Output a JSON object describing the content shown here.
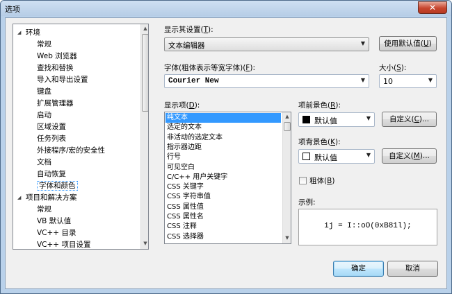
{
  "window": {
    "title": "选项",
    "close_glyph": "✕"
  },
  "tree": {
    "items": [
      {
        "label": "环境",
        "level": 0,
        "expander": "◢"
      },
      {
        "label": "常规",
        "level": 1
      },
      {
        "label": "Web 浏览器",
        "level": 1
      },
      {
        "label": "查找和替换",
        "level": 1
      },
      {
        "label": "导入和导出设置",
        "level": 1
      },
      {
        "label": "键盘",
        "level": 1
      },
      {
        "label": "扩展管理器",
        "level": 1
      },
      {
        "label": "启动",
        "level": 1
      },
      {
        "label": "区域设置",
        "level": 1
      },
      {
        "label": "任务列表",
        "level": 1
      },
      {
        "label": "外接程序/宏的安全性",
        "level": 1
      },
      {
        "label": "文档",
        "level": 1
      },
      {
        "label": "自动恢复",
        "level": 1
      },
      {
        "label": "字体和颜色",
        "level": 1,
        "selected": true
      },
      {
        "label": "项目和解决方案",
        "level": 0,
        "expander": "◢"
      },
      {
        "label": "常规",
        "level": 1
      },
      {
        "label": "VB 默认值",
        "level": 1
      },
      {
        "label": "VC++ 目录",
        "level": 1
      },
      {
        "label": "VC++ 项目设置",
        "level": 1
      }
    ]
  },
  "show_settings_for": {
    "label": "显示其设置(",
    "mnemonic": "T",
    "suffix": "):",
    "value": "文本编辑器"
  },
  "use_defaults_button": {
    "label": "使用默认值(",
    "mnemonic": "U",
    "suffix": ")"
  },
  "font": {
    "label": "字体(粗体表示等宽字体)(",
    "mnemonic": "F",
    "suffix": "):",
    "value": "Courier New"
  },
  "size": {
    "label": "大小(",
    "mnemonic": "S",
    "suffix": "):",
    "value": "10"
  },
  "display_items": {
    "label": "显示项(",
    "mnemonic": "D",
    "suffix": "):",
    "items": [
      {
        "label": "纯文本",
        "selected": true
      },
      {
        "label": "选定的文本"
      },
      {
        "label": "非活动的选定文本"
      },
      {
        "label": "指示器边距"
      },
      {
        "label": "行号"
      },
      {
        "label": "可见空白"
      },
      {
        "label": "C/C++ 用户关键字"
      },
      {
        "label": "CSS 关键字"
      },
      {
        "label": "CSS 字符串值"
      },
      {
        "label": "CSS 属性值"
      },
      {
        "label": "CSS 属性名"
      },
      {
        "label": "CSS 注释"
      },
      {
        "label": "CSS 选择器"
      }
    ]
  },
  "foreground": {
    "label": "项前景色(",
    "mnemonic": "R",
    "suffix": "):",
    "value": "默认值",
    "swatch_color": "#000000",
    "custom_button": {
      "label": "自定义(",
      "mnemonic": "C",
      "suffix": ")..."
    }
  },
  "background": {
    "label": "项背景色(",
    "mnemonic": "K",
    "suffix": "):",
    "value": "默认值",
    "swatch_color": "#ffffff",
    "custom_button": {
      "label": "自定义(",
      "mnemonic": "M",
      "suffix": ")..."
    }
  },
  "bold": {
    "label": "粗体(",
    "mnemonic": "B",
    "suffix": ")",
    "checked": false
  },
  "sample": {
    "label": "示例:",
    "text": "ij = I::oO(0xB81l);"
  },
  "ok_button": {
    "label": "确定"
  },
  "cancel_button": {
    "label": "取消"
  },
  "colors": {
    "selection": "#3399ff",
    "dialog_bg": "#f0f0f0",
    "frame": "#b9d1ea"
  }
}
